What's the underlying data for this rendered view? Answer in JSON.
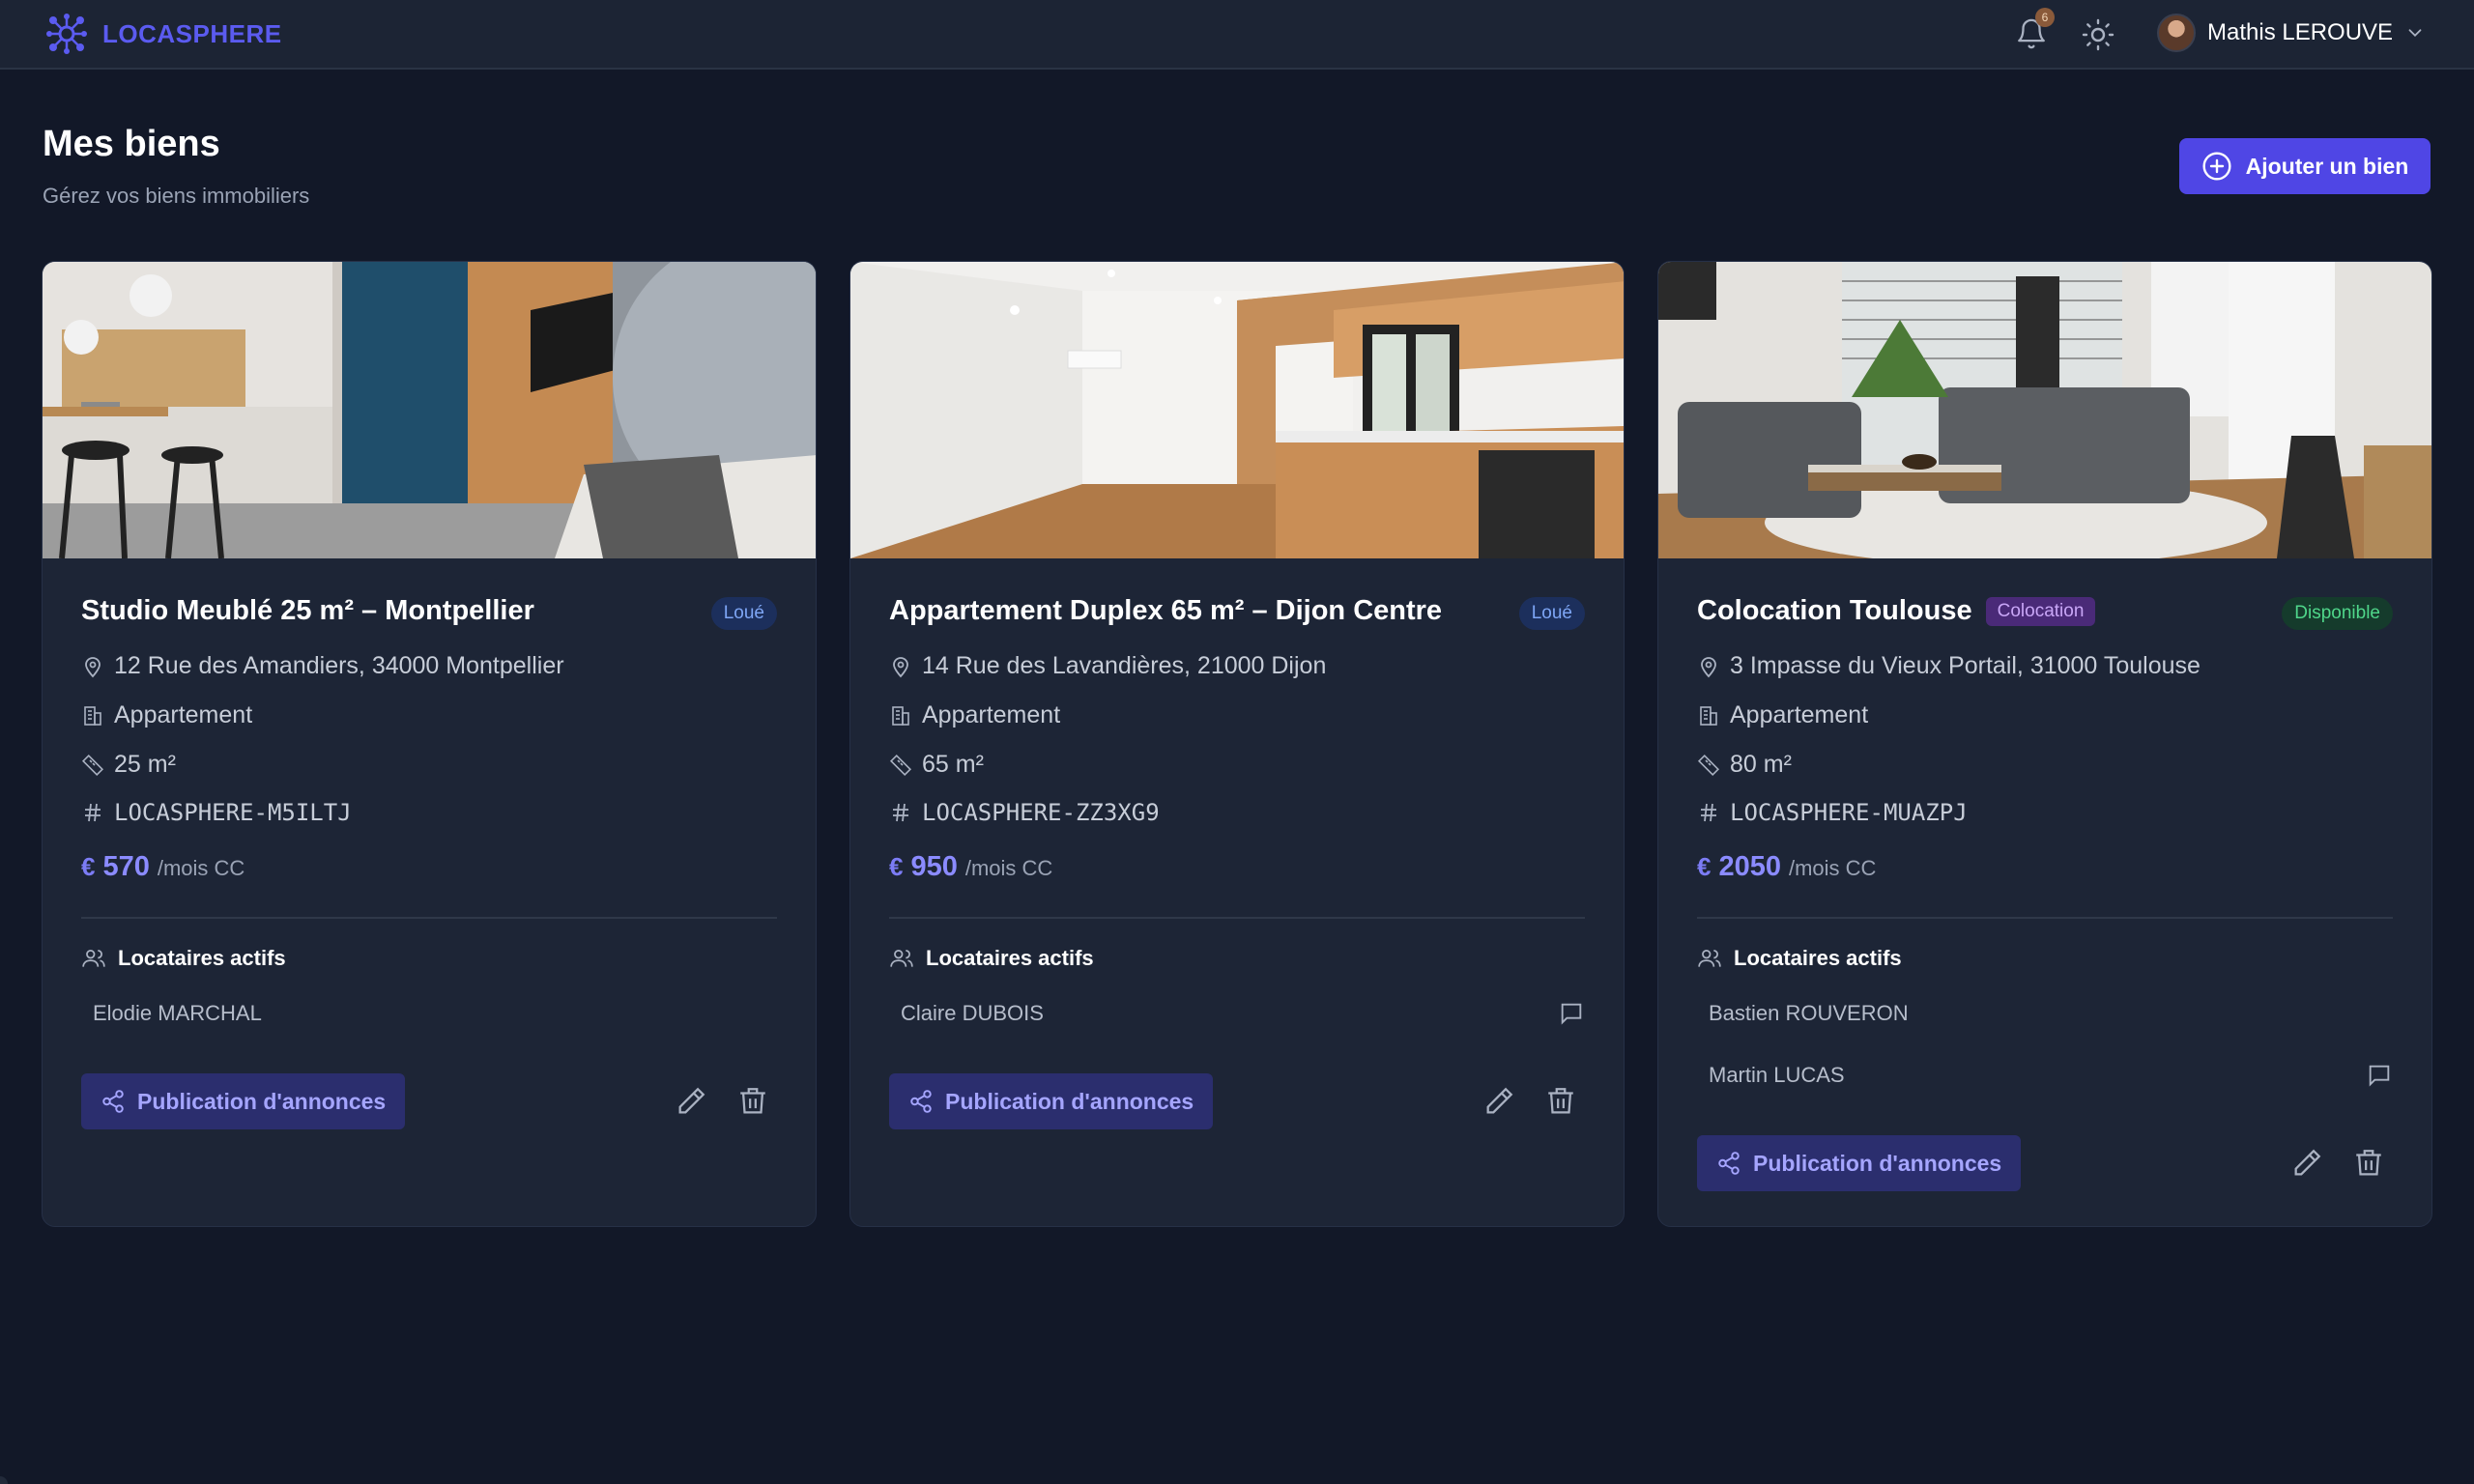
{
  "header": {
    "brand": "LOCASPHERE",
    "notifications_count": "6",
    "user_name": "Mathis LEROUVE"
  },
  "page": {
    "title": "Mes biens",
    "subtitle": "Gérez vos biens immobiliers",
    "add_button": "Ajouter un bien"
  },
  "labels": {
    "tenants_heading": "Locataires actifs",
    "publish_button": "Publication d'annonces",
    "per_month": "/mois CC",
    "currency": "€"
  },
  "properties": [
    {
      "title": "Studio Meublé 25 m² – Montpellier",
      "status": "Loué",
      "address": "12 Rue des Amandiers, 34000 Montpellier",
      "type": "Appartement",
      "surface": "25 m²",
      "reference": "LOCASPHERE-M5ILTJ",
      "price": "570",
      "tenants": [
        "Elodie MARCHAL"
      ]
    },
    {
      "title": "Appartement Duplex 65 m² – Dijon Centre",
      "status": "Loué",
      "address": "14 Rue des Lavandières, 21000 Dijon",
      "type": "Appartement",
      "surface": "65 m²",
      "reference": "LOCASPHERE-ZZ3XG9",
      "price": "950",
      "tenants": [
        "Claire DUBOIS"
      ]
    },
    {
      "title": "Colocation Toulouse",
      "tag": "Colocation",
      "status": "Disponible",
      "address": "3 Impasse du Vieux Portail, 31000 Toulouse",
      "type": "Appartement",
      "surface": "80 m²",
      "reference": "LOCASPHERE-MUAZPJ",
      "price": "2050",
      "tenants": [
        "Bastien ROUVERON",
        "Martin LUCAS"
      ]
    }
  ],
  "colors": {
    "background": "#121828",
    "card": "#1d2536",
    "accent": "#4f46e5",
    "status_rented_bg": "#1c2f5c",
    "status_available_bg": "#153b2c"
  },
  "icons": [
    "logo-icon",
    "bell-icon",
    "sun-icon",
    "chevron-down-icon",
    "plus-circle-icon",
    "map-pin-icon",
    "building-icon",
    "ruler-icon",
    "hash-icon",
    "euro-icon",
    "users-icon",
    "message-icon",
    "share-icon",
    "pencil-icon",
    "trash-icon"
  ]
}
